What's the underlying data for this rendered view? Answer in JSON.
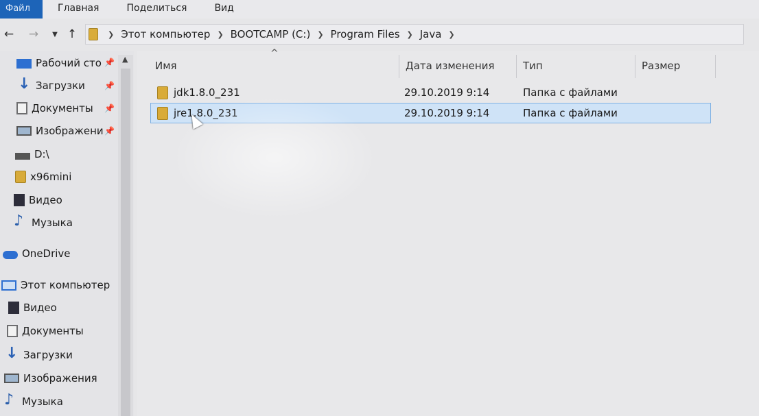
{
  "ribbon": {
    "tabs": [
      "Файл",
      "Главная",
      "Поделиться",
      "Вид"
    ]
  },
  "address": {
    "crumbs": [
      "Этот компьютер",
      "BOOTCAMP (C:)",
      "Program Files",
      "Java"
    ]
  },
  "nav": {
    "items": [
      {
        "label": "Рабочий сто",
        "icon": "desktop-icon",
        "pinned": true
      },
      {
        "label": "Загрузки",
        "icon": "download-icon",
        "pinned": true
      },
      {
        "label": "Документы",
        "icon": "documents-icon",
        "pinned": true
      },
      {
        "label": "Изображени",
        "icon": "pictures-icon",
        "pinned": true
      },
      {
        "label": "D:\\",
        "icon": "drive-icon",
        "pinned": false
      },
      {
        "label": "x96mini",
        "icon": "folder-icon",
        "pinned": false
      },
      {
        "label": "Видео",
        "icon": "video-icon",
        "pinned": false
      },
      {
        "label": "Музыка",
        "icon": "music-icon",
        "pinned": false
      },
      {
        "label": "OneDrive",
        "icon": "cloud-icon",
        "pinned": false
      },
      {
        "label": "Этот компьютер",
        "icon": "computer-icon",
        "pinned": false
      },
      {
        "label": "Видео",
        "icon": "video-icon",
        "pinned": false
      },
      {
        "label": "Документы",
        "icon": "documents-icon",
        "pinned": false
      },
      {
        "label": "Загрузки",
        "icon": "download-icon",
        "pinned": false
      },
      {
        "label": "Изображения",
        "icon": "pictures-icon",
        "pinned": false
      },
      {
        "label": "Музыка",
        "icon": "music-icon",
        "pinned": false
      }
    ]
  },
  "columns": {
    "name": "Имя",
    "date": "Дата изменения",
    "type": "Тип",
    "size": "Размер"
  },
  "files": [
    {
      "name": "jdk1.8.0_231",
      "date": "29.10.2019 9:14",
      "type": "Папка с файлами",
      "selected": false
    },
    {
      "name": "jre1.8.0_231",
      "date": "29.10.2019 9:14",
      "type": "Папка с файлами",
      "selected": true
    }
  ],
  "colors": {
    "file_tab": "#1d64b8",
    "selection": "#cfe3f7",
    "selection_border": "#7fb0e3",
    "folder": "#d9ab38"
  }
}
